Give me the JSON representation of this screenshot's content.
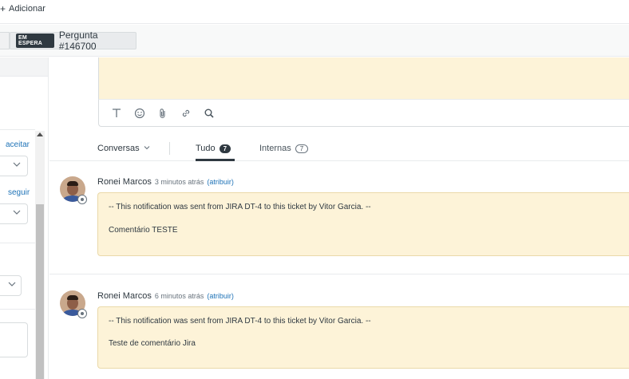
{
  "topbar": {
    "add_label": "Adicionar",
    "add_icon": "plus-icon"
  },
  "ticket_tab": {
    "status": "EM ESPERA",
    "label": "Pergunta #146700"
  },
  "left_panel": {
    "accept_link": "aceitar",
    "follow_link": "seguir"
  },
  "composer": {
    "tools": [
      "text-format-icon",
      "emoji-icon",
      "attachment-icon",
      "link-icon",
      "search-icon"
    ]
  },
  "filters": {
    "conversations_label": "Conversas",
    "tabs": [
      {
        "label": "Tudo",
        "count": "7"
      },
      {
        "label": "Internas",
        "count": "7"
      }
    ]
  },
  "events": [
    {
      "author": "Ronei Marcos",
      "time": "3 minutos atrás",
      "assign": "(atribuir)",
      "line1": "-- This notification was sent from JIRA DT-4 to this ticket by Vitor Garcia. --",
      "line2": "Comentário TESTE"
    },
    {
      "author": "Ronei Marcos",
      "time": "6 minutos atrás",
      "assign": "(atribuir)",
      "line1": "-- This notification was sent from JIRA DT-4 to this ticket by Vitor Garcia. --",
      "line2": "Teste de comentário Jira"
    }
  ],
  "colors": {
    "note_bg": "#fdf3d8",
    "accent_link": "#1f73b7",
    "dark": "#2f3941"
  }
}
